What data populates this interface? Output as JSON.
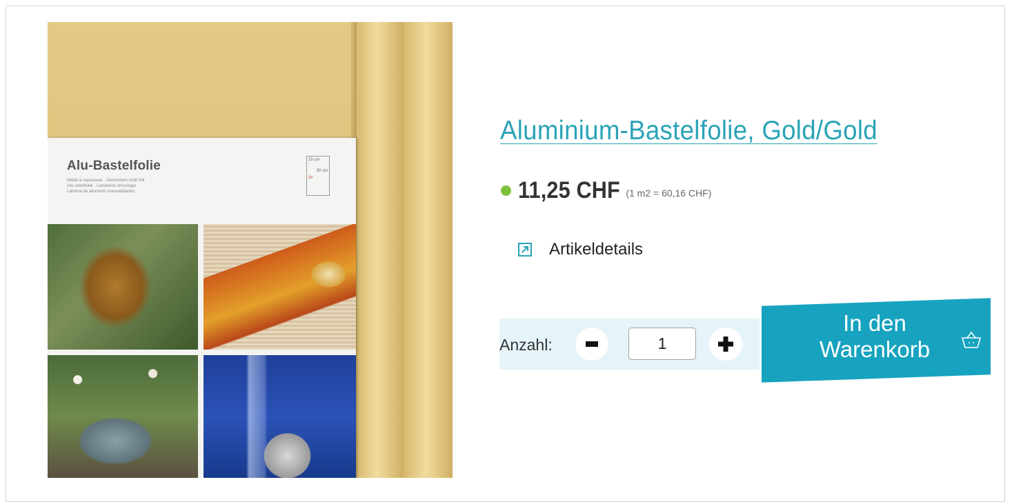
{
  "product": {
    "title": "Aluminium-Bastelfolie, Gold/Gold",
    "price": "11,25 CHF",
    "unit_price": "(1 m2 = 60,16 CHF)",
    "stock_color": "#7cc13a"
  },
  "image": {
    "pack_title": "Alu-Bastelfolie",
    "pack_subtitle_lines": [
      "Métal à repousser · Aluminium craft foil",
      "Alu-relieffolie · Lamierino bricolage",
      "Lámina de aluminio manualidades"
    ],
    "pack_size": [
      "20 cm",
      "30 cm",
      "3×"
    ]
  },
  "details": {
    "label": "Artikeldetails",
    "icon": "external-link-icon"
  },
  "quantity": {
    "label": "Anzahl:",
    "value": "1",
    "minus_icon": "minus-icon",
    "plus_icon": "plus-icon"
  },
  "cart": {
    "label_line1": "In den",
    "label_line2": "Warenkorb",
    "icon": "basket-icon",
    "color": "#17a3bf"
  },
  "colors": {
    "accent": "#2aa3b7",
    "qty_panel": "#e5f4f8"
  }
}
